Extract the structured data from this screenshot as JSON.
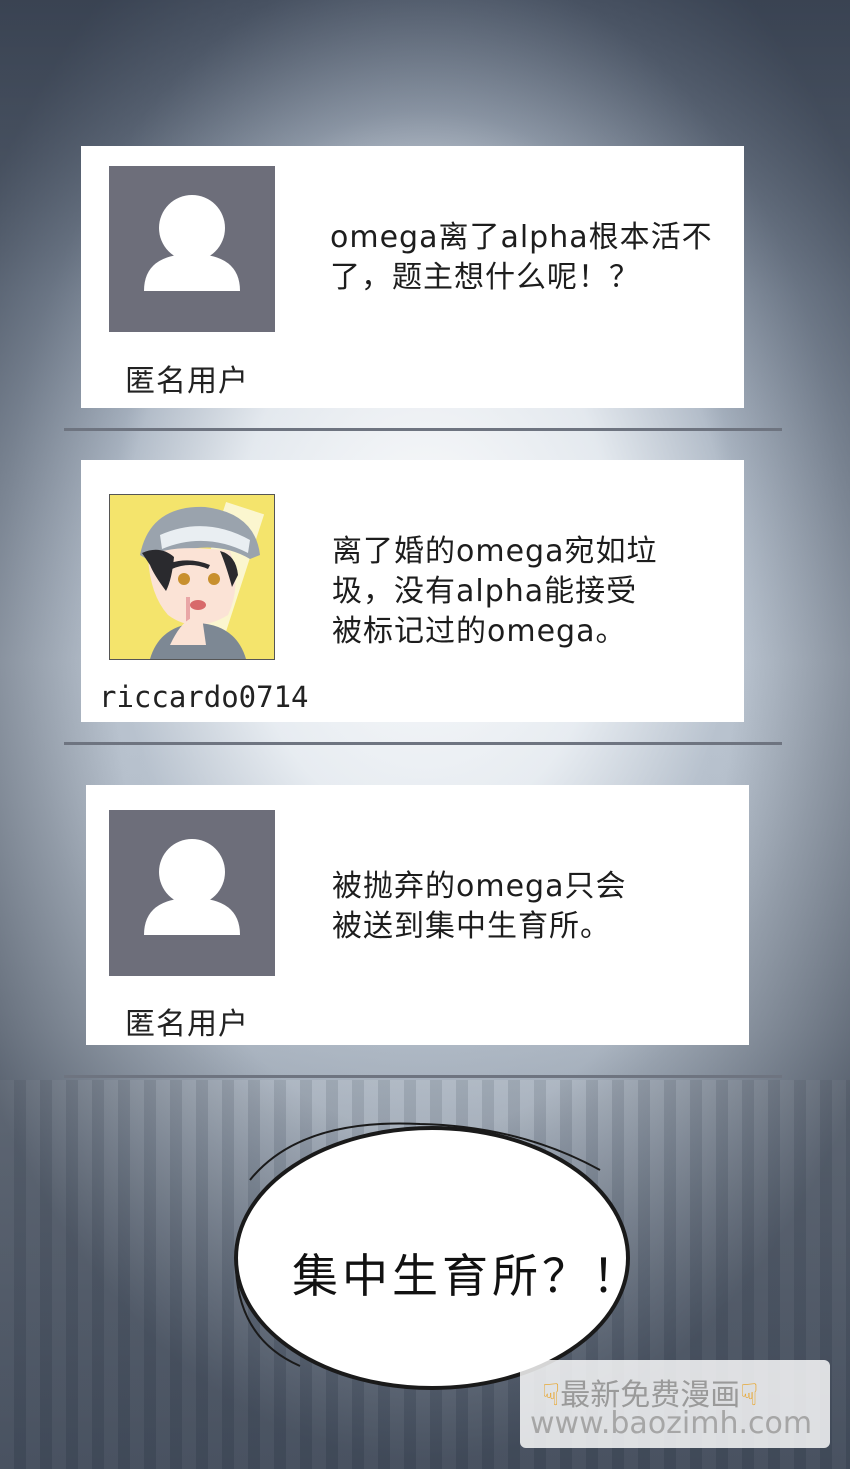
{
  "comments": [
    {
      "username": "匿名用户",
      "avatar": "default-user-icon",
      "lines": [
        "omega离了alpha根本活不",
        "了，题主想什么呢！？"
      ]
    },
    {
      "username": "riccardo0714",
      "avatar": "anime-boy-avatar",
      "lines": [
        "离了婚的omega宛如垃",
        "圾，没有alpha能接受",
        "被标记过的omega。"
      ]
    },
    {
      "username": "匿名用户",
      "avatar": "default-user-icon",
      "lines": [
        "被抛弃的omega只会",
        "被送到集中生育所。"
      ]
    }
  ],
  "speech_bubble": {
    "text": "集中生育所？！"
  },
  "watermark": {
    "line1": "最新免费漫画",
    "line2": "www.baozimh.com",
    "hand_icon": "pointing-down-hand-icon"
  },
  "colors": {
    "avatar_bg": "#6d6e7a",
    "card_bg": "#ffffff",
    "divider": "#6e7480"
  }
}
